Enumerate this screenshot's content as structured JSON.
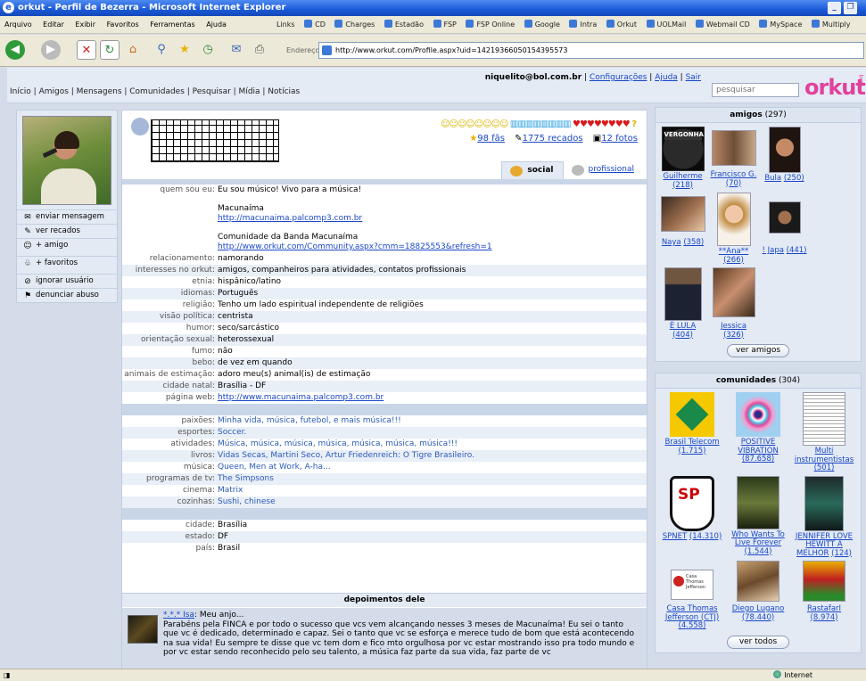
{
  "window": {
    "title": "orkut - Perfil de Bezerra - Microsoft Internet Explorer",
    "ie_glyph": "e",
    "minimize": "_",
    "restore": "❐",
    "menu": [
      "Arquivo",
      "Editar",
      "Exibir",
      "Favoritos",
      "Ferramentas",
      "Ajuda"
    ],
    "links_label": "Links",
    "links": [
      "CD",
      "Charges",
      "Estadão",
      "FSP",
      "FSP Online",
      "Google",
      "Intra",
      "Orkut",
      "UOLMail",
      "Webmail CD",
      "MySpace",
      "Multiply"
    ],
    "address_label": "Endereço",
    "address": "http://www.orkut.com/Profile.aspx?uid=14219366050154395573",
    "toolbar_icons": [
      "back-icon",
      "forward-icon",
      "stop-icon",
      "refresh-icon",
      "home-icon",
      "search-icon",
      "favorites-icon",
      "history-icon",
      "mail-icon",
      "print-icon"
    ],
    "status_zone": "Internet"
  },
  "orkut": {
    "user_email": "niquelito@bol.com.br",
    "sep": " | ",
    "top_links": [
      "Configurações",
      "Ajuda",
      "Sair"
    ],
    "nav": "Início | Amigos | Mensagens | Comunidades | Pesquisar | Mídia | Notícias",
    "search_placeholder": "pesquisar",
    "logo": "orkut",
    "beta": "beta"
  },
  "left_actions": [
    "enviar mensagem",
    "ver recados",
    "+ amigo",
    "+ favoritos",
    "ignorar usuário",
    "denunciar abuso"
  ],
  "header": {
    "badges": {
      "smile": "☺☺☺☺☺☺☺☺",
      "cool": "▥▥▥▥▥▥▥▥",
      "sexy": "♥♥♥♥♥♥♥♥",
      "help": "?"
    },
    "fans_num": "98",
    "fans_label": " fãs",
    "scraps_num": "1775",
    "scraps_label": " recados",
    "photos_num": "12",
    "photos_label": " fotos",
    "tab_social": "social",
    "tab_profissional": "profissional"
  },
  "profile": {
    "about_key": "quem sou eu:",
    "about_text": "Eu sou músico! Vivo para a música!",
    "band": "Macunaíma",
    "band_link": "http://macunaima.palcomp3.com.br",
    "community_label": "Comunidade da Banda Macunaíma",
    "community_link": "http://www.orkut.com/Community.aspx?cmm=18825553&refresh=1",
    "rows": [
      {
        "k": "relacionamento:",
        "v": "namorando"
      },
      {
        "k": "interesses no orkut:",
        "v": "amigos, companheiros para atividades, contatos profissionais"
      },
      {
        "k": "etnia:",
        "v": "hispânico/latino"
      },
      {
        "k": "idiomas:",
        "v": "Português"
      },
      {
        "k": "religião:",
        "v": "Tenho um lado espiritual independente de religiões"
      },
      {
        "k": "visão política:",
        "v": "centrista"
      },
      {
        "k": "humor:",
        "v": "seco/sarcástico"
      },
      {
        "k": "orientação sexual:",
        "v": "heterossexual"
      },
      {
        "k": "fumo:",
        "v": "não"
      },
      {
        "k": "bebo:",
        "v": "de vez em quando"
      },
      {
        "k": "animais de estimação:",
        "v": "adoro meu(s) animal(is) de estimação"
      },
      {
        "k": "cidade natal:",
        "v": "Brasília - DF"
      },
      {
        "k": "página web:",
        "v": "http://www.macunaima.palcomp3.com.br"
      }
    ],
    "personal": [
      {
        "k": "paixões:",
        "v": "Minha vida, música, futebol, e mais música!!!"
      },
      {
        "k": "esportes:",
        "v": "Soccer."
      },
      {
        "k": "atividades:",
        "v": "Música, música, música, música, música, música, música!!!"
      },
      {
        "k": "livros:",
        "v": "Vidas Secas, Martini Seco, Artur Friedenreich: O Tigre Brasileiro."
      },
      {
        "k": "música:",
        "v": "Queen, Men at Work, A-ha..."
      },
      {
        "k": "programas de tv:",
        "v": "The Simpsons"
      },
      {
        "k": "cinema:",
        "v": "Matrix"
      },
      {
        "k": "cozinhas:",
        "v": "Sushi, chinese"
      }
    ],
    "location": [
      {
        "k": "cidade:",
        "v": "Brasília"
      },
      {
        "k": "estado:",
        "v": "DF"
      },
      {
        "k": "país:",
        "v": "Brasil"
      }
    ]
  },
  "testimonials": {
    "title": "depoimentos dele",
    "author": "*.*.* Isa",
    "lead": ": Meu anjo...",
    "body": "Parabéns pela FINCA e por todo o sucesso que vcs vem alcançando nesses 3 meses de Macunaíma! Eu sei o tanto que vc é dedicado, determinado e capaz. Sei o tanto que vc se esforça e merece tudo de bom que está acontecendo na sua vida! Eu sempre te disse que vc tem dom e fico mto orgulhosa por vc estar mostrando isso pra todo mundo e por vc estar sendo reconhecido pelo seu talento, a música faz parte da sua vida, faz parte de vc"
  },
  "friends": {
    "title": "amigos",
    "count": "(297)",
    "items": [
      {
        "name": "Guilherme",
        "count": "(218)"
      },
      {
        "name": "Francisco G.",
        "count": "(70)"
      },
      {
        "name": "Bula",
        "count": "(250)"
      },
      {
        "name": "Naya",
        "count": "(358)"
      },
      {
        "name": "**Ana**",
        "count": "(266)"
      },
      {
        "name": "! Japa",
        "count": "(441)"
      },
      {
        "name": "É LULA",
        "count": "(404)"
      },
      {
        "name": "Jessica",
        "count": "(326)"
      }
    ],
    "vergonha_text": "VERGONHA",
    "button": "ver amigos"
  },
  "communities": {
    "title": "comunidades",
    "count": "(304)",
    "items": [
      {
        "name": "Brasil Telecom",
        "count": "(1.715)"
      },
      {
        "name": "POSITIVE VIBRATION",
        "count": "(87.658)"
      },
      {
        "name": "Multi instrumentistas",
        "count": "(501)"
      },
      {
        "name": "SPNET",
        "count": "(14.310)"
      },
      {
        "name": "Who Wants To Live Forever",
        "count": "(1.544)"
      },
      {
        "name": "JENNIFER LOVE HEWITT A MELHOR",
        "count": "(124)"
      },
      {
        "name": "Casa Thomas Jefferson (CTJ)",
        "count": "(4.558)"
      },
      {
        "name": "Diego Lugano",
        "count": "(78.440)"
      },
      {
        "name": "RastafarI",
        "count": "(8.974)"
      }
    ],
    "spnet_text": "SP",
    "ctj_text": "Casa Thomas Jefferson",
    "button": "ver todos"
  }
}
